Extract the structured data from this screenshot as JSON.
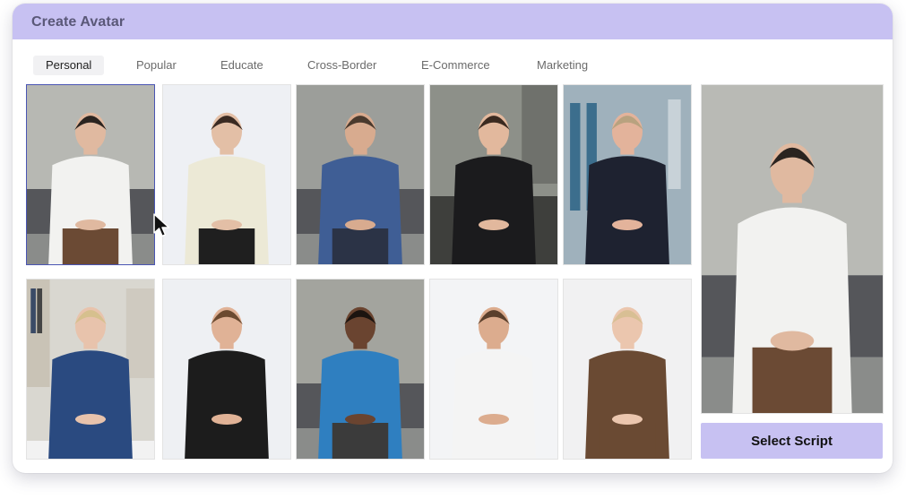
{
  "window": {
    "title": "Create Avatar"
  },
  "tabs": [
    {
      "label": "Personal",
      "active": true
    },
    {
      "label": "Popular",
      "active": false
    },
    {
      "label": "Educate",
      "active": false
    },
    {
      "label": "Cross-Border",
      "active": false
    },
    {
      "label": "E-Commerce",
      "active": false
    },
    {
      "label": "Marketing",
      "active": false
    }
  ],
  "avatars": [
    {
      "name": "man-white-shirt-sofa",
      "selected": true,
      "scene": "living-room",
      "bg": "#b7b8b3",
      "top": "#f2f2f0",
      "bottom": "#6b4a34",
      "hair": "#2b2420",
      "skin": "#e0b9a0"
    },
    {
      "name": "woman-cream-blouse",
      "selected": false,
      "scene": "studio",
      "bg": "#eef0f4",
      "top": "#ece9d6",
      "bottom": "#1f1f1f",
      "hair": "#3a2a22",
      "skin": "#e3bfa6"
    },
    {
      "name": "man-plaid-shirt",
      "selected": false,
      "scene": "living-room",
      "bg": "#9c9e9a",
      "top": "#3f5e95",
      "bottom": "#2b3346",
      "hair": "#4a3a2e",
      "skin": "#d8ab8f"
    },
    {
      "name": "woman-black-blazer",
      "selected": false,
      "scene": "office",
      "bg": "#8d9089",
      "top": "#1b1b1d",
      "bottom": "#1b1b1d",
      "hair": "#3b2a20",
      "skin": "#e2b89d"
    },
    {
      "name": "man-dark-shirt",
      "selected": false,
      "scene": "office-blue",
      "bg": "#9fb1bc",
      "top": "#1e2230",
      "bottom": "#1e2230",
      "hair": "#b8a27f",
      "skin": "#e3b39b"
    },
    {
      "name": "woman-blue-blazer",
      "selected": false,
      "scene": "bookshelf",
      "bg": "#d9d7d0",
      "top": "#2a4a80",
      "bottom": "#2a4a80",
      "hair": "#d6c08e",
      "skin": "#e8c3ac"
    },
    {
      "name": "man-black-tshirt",
      "selected": false,
      "scene": "studio",
      "bg": "#eef0f3",
      "top": "#1c1c1c",
      "bottom": "#1c1c1c",
      "hair": "#6b4a30",
      "skin": "#e0b296"
    },
    {
      "name": "woman-blue-sweater",
      "selected": false,
      "scene": "living-room",
      "bg": "#a3a49e",
      "top": "#2f7fc0",
      "bottom": "#3b3b3b",
      "hair": "#1c1410",
      "skin": "#6a4430"
    },
    {
      "name": "man-lab-coat",
      "selected": false,
      "scene": "studio",
      "bg": "#f3f4f6",
      "top": "#f4f4f4",
      "bottom": "#f4f4f4",
      "hair": "#5a3f2c",
      "skin": "#dcac8e"
    },
    {
      "name": "woman-brown-blazer",
      "selected": false,
      "scene": "studio",
      "bg": "#f1f1f2",
      "top": "#6a4a33",
      "bottom": "#6a4a33",
      "hair": "#d8bf94",
      "skin": "#ebc6ae"
    }
  ],
  "preview": {
    "name": "selected-avatar-preview",
    "bg": "#b9bab5",
    "top": "#f2f2f0",
    "bottom": "#6b4a34",
    "hair": "#2b2420",
    "skin": "#e0b9a0"
  },
  "actions": {
    "select_script_label": "Select Script"
  },
  "colors": {
    "accent": "#c7c1f2",
    "title_text": "#5a5878",
    "selection_border": "#4a55b3"
  }
}
